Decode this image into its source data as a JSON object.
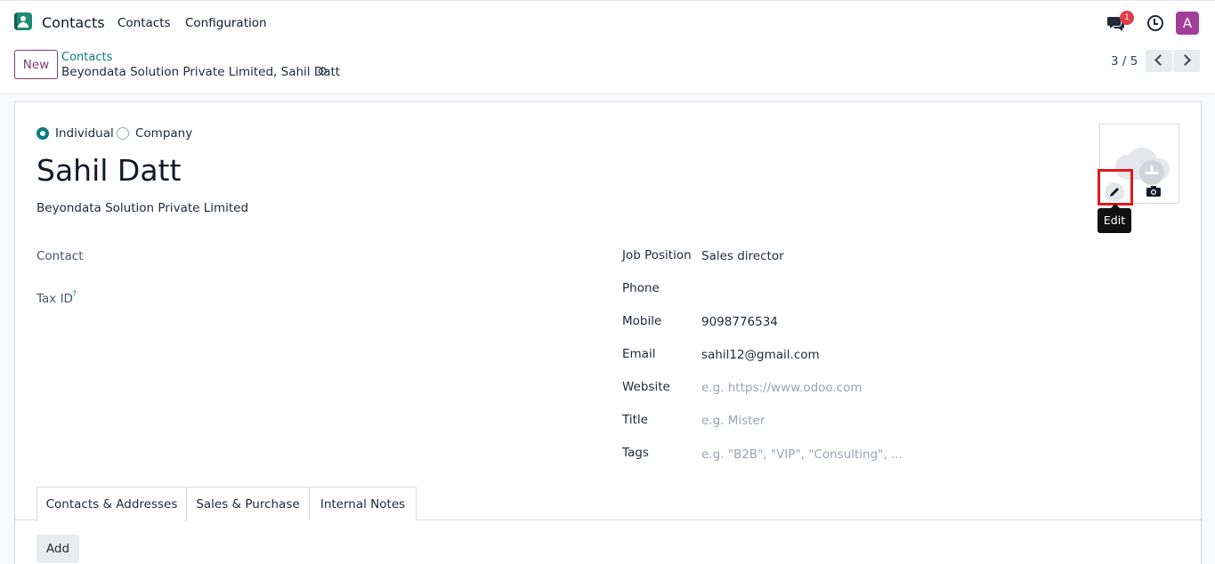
{
  "navbar": {
    "app_name": "Contacts",
    "menu": [
      "Contacts",
      "Configuration"
    ],
    "chat_badge": "1",
    "user_initial": "A"
  },
  "control_panel": {
    "new_label": "New",
    "breadcrumb_parent": "Contacts",
    "breadcrumb_current": "Beyondata Solution Private Limited, Sahil Datt",
    "pager": "3 / 5"
  },
  "form": {
    "type_options": [
      "Individual",
      "Company"
    ],
    "type_selected": "Individual",
    "name": "Sahil Datt",
    "company": "Beyondata Solution Private Limited",
    "image_tooltip": "Edit",
    "left_fields": {
      "contact_label": "Contact",
      "tax_id_label": "Tax ID",
      "tax_id_help": "?"
    },
    "right_fields": [
      {
        "label": "Job Position",
        "value": "Sales director",
        "placeholder": ""
      },
      {
        "label": "Phone",
        "value": "",
        "placeholder": ""
      },
      {
        "label": "Mobile",
        "value": "9098776534",
        "placeholder": ""
      },
      {
        "label": "Email",
        "value": "sahil12@gmail.com",
        "placeholder": ""
      },
      {
        "label": "Website",
        "value": "",
        "placeholder": "e.g. https://www.odoo.com"
      },
      {
        "label": "Title",
        "value": "",
        "placeholder": "e.g. Mister"
      },
      {
        "label": "Tags",
        "value": "",
        "placeholder": "e.g. \"B2B\", \"VIP\", \"Consulting\", ..."
      }
    ],
    "tabs": [
      "Contacts & Addresses",
      "Sales & Purchase",
      "Internal Notes"
    ],
    "active_tab": "Contacts & Addresses",
    "add_label": "Add"
  },
  "colors": {
    "brand": "#7b3f67",
    "link": "#0b7d80",
    "highlight": "#e0191f",
    "badge": "#e13d49",
    "avatar": "#a23d9c"
  }
}
